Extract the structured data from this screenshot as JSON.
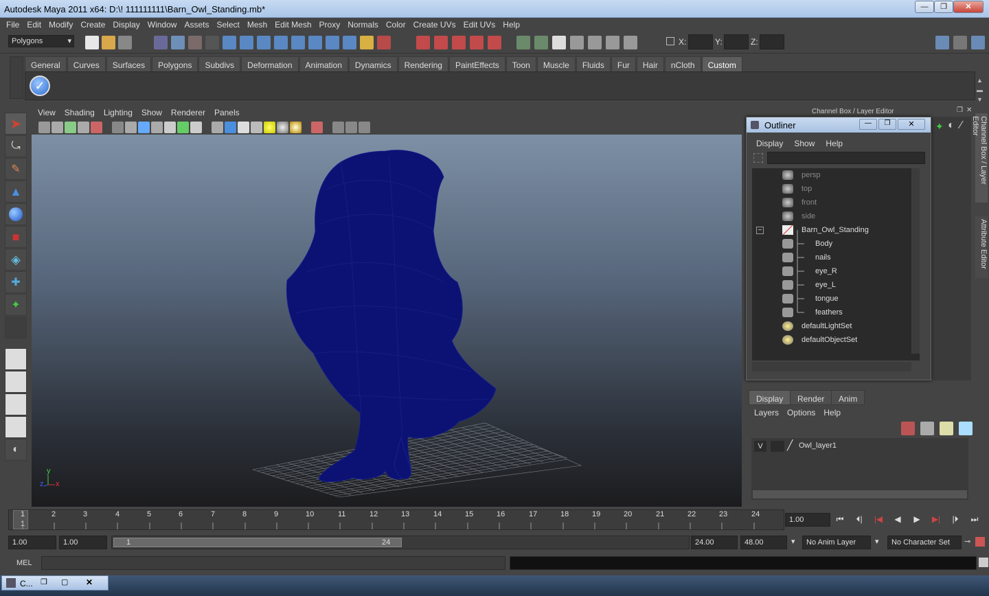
{
  "window": {
    "title": "Autodesk Maya 2011 x64: D:\\! 111111111\\Barn_Owl_Standing.mb*",
    "min": "—",
    "max": "❐",
    "close": "✕"
  },
  "menubar": [
    "File",
    "Edit",
    "Modify",
    "Create",
    "Display",
    "Window",
    "Assets",
    "Select",
    "Mesh",
    "Edit Mesh",
    "Proxy",
    "Normals",
    "Color",
    "Create UVs",
    "Edit UVs",
    "Help"
  ],
  "status": {
    "mode": "Polygons",
    "x_label": "X:",
    "y_label": "Y:",
    "z_label": "Z:"
  },
  "shelf": {
    "tabs": [
      "General",
      "Curves",
      "Surfaces",
      "Polygons",
      "Subdivs",
      "Deformation",
      "Animation",
      "Dynamics",
      "Rendering",
      "PaintEffects",
      "Toon",
      "Muscle",
      "Fluids",
      "Fur",
      "Hair",
      "nCloth",
      "Custom"
    ],
    "active": "Custom"
  },
  "viewport": {
    "menu": [
      "View",
      "Shading",
      "Lighting",
      "Show",
      "Renderer",
      "Panels"
    ],
    "axis": {
      "y": "y",
      "z": "z",
      "x": "x"
    }
  },
  "channel_box_header": "Channel Box / Layer Editor",
  "side_tabs": {
    "channel": "Channel Box / Layer Editor",
    "attribute": "Attribute Editor"
  },
  "outliner": {
    "title": "Outliner",
    "menu": [
      "Display",
      "Show",
      "Help"
    ],
    "items": [
      {
        "label": "persp",
        "dim": true,
        "depth": 0
      },
      {
        "label": "top",
        "dim": true,
        "depth": 0
      },
      {
        "label": "front",
        "dim": true,
        "depth": 0
      },
      {
        "label": "side",
        "dim": true,
        "depth": 0
      },
      {
        "label": "Barn_Owl_Standing",
        "dim": false,
        "depth": 0
      },
      {
        "label": "Body",
        "dim": false,
        "depth": 1
      },
      {
        "label": "nails",
        "dim": false,
        "depth": 1
      },
      {
        "label": "eye_R",
        "dim": false,
        "depth": 1
      },
      {
        "label": "eye_L",
        "dim": false,
        "depth": 1
      },
      {
        "label": "tongue",
        "dim": false,
        "depth": 1
      },
      {
        "label": "feathers",
        "dim": false,
        "depth": 1
      },
      {
        "label": "defaultLightSet",
        "dim": false,
        "depth": 0
      },
      {
        "label": "defaultObjectSet",
        "dim": false,
        "depth": 0
      }
    ]
  },
  "layer_editor": {
    "tabs": [
      "Display",
      "Render",
      "Anim"
    ],
    "menu": [
      "Layers",
      "Options",
      "Help"
    ],
    "layer": {
      "visible": "V",
      "name": "Owl_layer1"
    }
  },
  "timeline": {
    "ticks": [
      "1",
      "2",
      "3",
      "4",
      "5",
      "6",
      "7",
      "8",
      "9",
      "10",
      "11",
      "12",
      "13",
      "14",
      "15",
      "16",
      "17",
      "18",
      "19",
      "20",
      "21",
      "22",
      "23",
      "24"
    ],
    "current": "1",
    "current_field": "1.00"
  },
  "range": {
    "start": "1.00",
    "playback_start": "1.00",
    "slider_start": "1",
    "slider_end": "24",
    "playback_end": "24.00",
    "end": "48.00",
    "anim_layer": "No Anim Layer",
    "char_set": "No Character Set"
  },
  "mel": {
    "label": "MEL"
  },
  "taskbar": {
    "app": "C..."
  }
}
